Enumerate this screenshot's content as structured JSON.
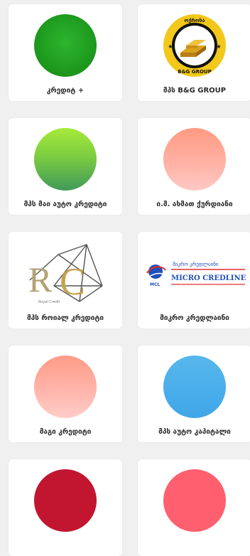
{
  "cards": [
    {
      "label": "კრედიტ +",
      "logo": "green-circle"
    },
    {
      "label": "მპს B&G GROUP",
      "logo": "b-g-group-logo",
      "logo_text": "ᲝᲥᲠᲝᲡᲐ B&G GROUP"
    },
    {
      "label": "მპს მაი აუტო კრედიტი",
      "logo": "lime-gradient-circle"
    },
    {
      "label": "ი.მ. ახმათ ქურდიანი",
      "logo": "salmon-circle"
    },
    {
      "label": "მპს როიალ კრედიტი",
      "logo": "rc-logo",
      "logo_text": "RC"
    },
    {
      "label": "მიკრო კრედლაინი",
      "logo": "micro-credline-logo",
      "logo_text": "MICRO CREDLINE"
    },
    {
      "label": "მაგი კრედიტი",
      "logo": "peach-circle"
    },
    {
      "label": "მპს აუტო კაპიტალი",
      "logo": "blue-circle"
    },
    {
      "label": "",
      "logo": "red-circle"
    },
    {
      "label": "",
      "logo": "pink-circle"
    }
  ],
  "colors": {
    "page_bg": "#f0f0f0",
    "card_bg": "#ffffff",
    "green": "#1e9a1e",
    "blue": "#3fa6e8",
    "red": "#c11530",
    "pink": "#ff5f6e"
  }
}
